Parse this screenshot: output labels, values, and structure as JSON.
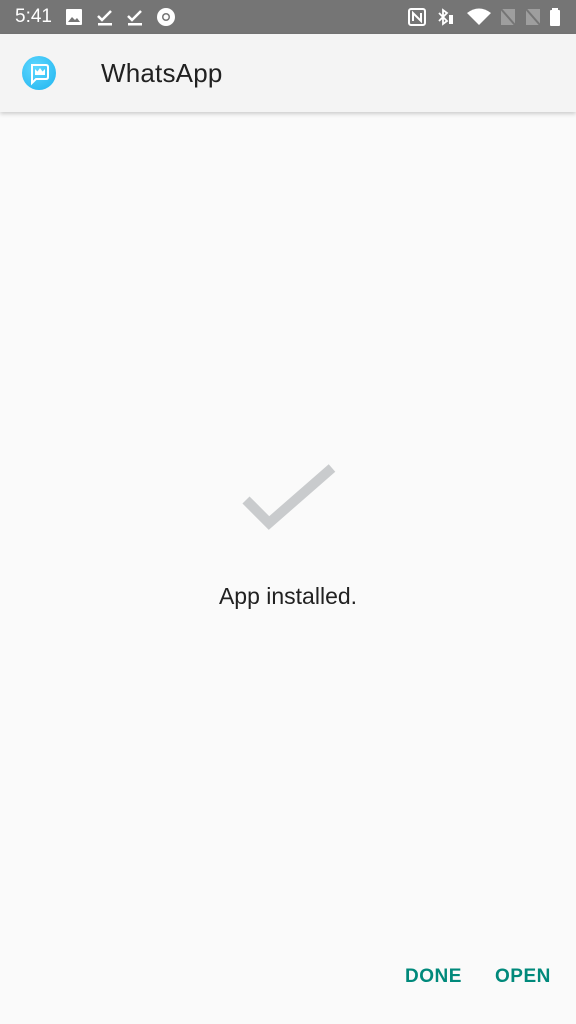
{
  "status_bar": {
    "time": "5:41",
    "left_icons": [
      "image-icon",
      "download-done-icon",
      "download-done-icon",
      "chrome-icon"
    ],
    "right_icons": [
      "nfc-icon",
      "bluetooth-icon",
      "wifi-icon",
      "no-sim-icon",
      "no-sim-icon",
      "battery-icon"
    ]
  },
  "app_bar": {
    "icon": "app-icon",
    "title": "WhatsApp"
  },
  "content": {
    "icon": "checkmark-icon",
    "message": "App installed."
  },
  "actions": {
    "done_label": "DONE",
    "open_label": "OPEN"
  },
  "colors": {
    "accent": "#00897b",
    "status_bar": "#757575",
    "app_bar": "#f4f4f4",
    "checkmark": "#c9cbcd"
  }
}
